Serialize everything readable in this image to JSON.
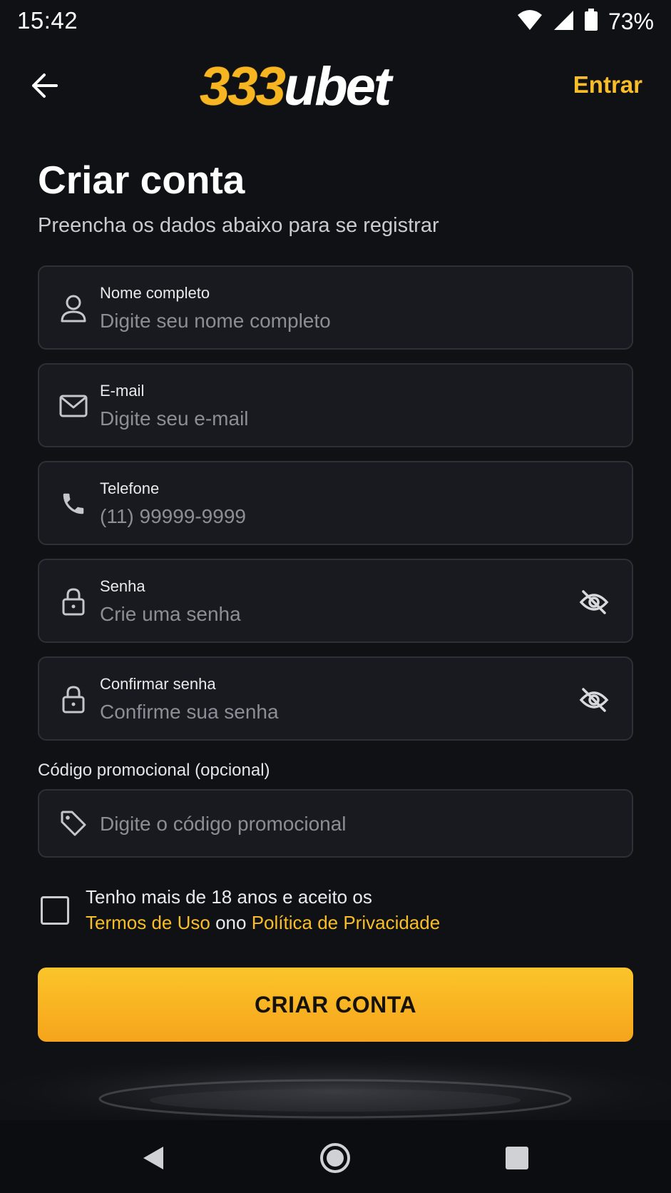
{
  "status_bar": {
    "time": "15:42",
    "battery_percent": "73%",
    "icons": [
      "wifi-icon",
      "signal-icon",
      "battery-icon"
    ]
  },
  "app_bar": {
    "back_icon": "arrow-left-icon",
    "logo_number": "333",
    "logo_text": "ubet",
    "login_label": "Entrar"
  },
  "header": {
    "title": "Criar conta",
    "subtitle": "Preencha os dados abaixo para se registrar"
  },
  "fields": {
    "name": {
      "label": "Nome completo",
      "placeholder": "Digite seu nome completo",
      "value": "",
      "icon": "user-icon"
    },
    "email": {
      "label": "E-mail",
      "placeholder": "Digite seu e-mail",
      "value": "",
      "icon": "mail-icon"
    },
    "phone": {
      "label": "Telefone",
      "placeholder": "(11) 99999-9999",
      "value": "",
      "icon": "phone-icon"
    },
    "password": {
      "label": "Senha",
      "placeholder": "Crie uma senha",
      "value": "",
      "icon": "lock-icon",
      "toggle_icon": "eye-off-icon"
    },
    "confirm_password": {
      "label": "Confirmar senha",
      "placeholder": "Confirme sua senha",
      "value": "",
      "icon": "lock-icon",
      "toggle_icon": "eye-off-icon"
    }
  },
  "promo": {
    "caption": "Código promocional (opcional)",
    "placeholder": "Digite o código promocional",
    "value": "",
    "icon": "tag-icon"
  },
  "terms": {
    "checked": false,
    "line1": "Tenho mais de 18 anos e aceito os",
    "terms_link": "Termos de Uso",
    "connector": "ono",
    "privacy_link": "Política de Privacidade"
  },
  "cta": {
    "label": "CRIAR CONTA"
  },
  "nav_bar": {
    "icons": [
      "back-triangle-icon",
      "home-circle-icon",
      "recents-square-icon"
    ]
  },
  "colors": {
    "background": "#0f1115",
    "field_bg": "#181a1f",
    "field_border": "#2d3037",
    "accent": "#f8bd27",
    "button_top": "#fbc52a",
    "button_bottom": "#f6a41b"
  }
}
